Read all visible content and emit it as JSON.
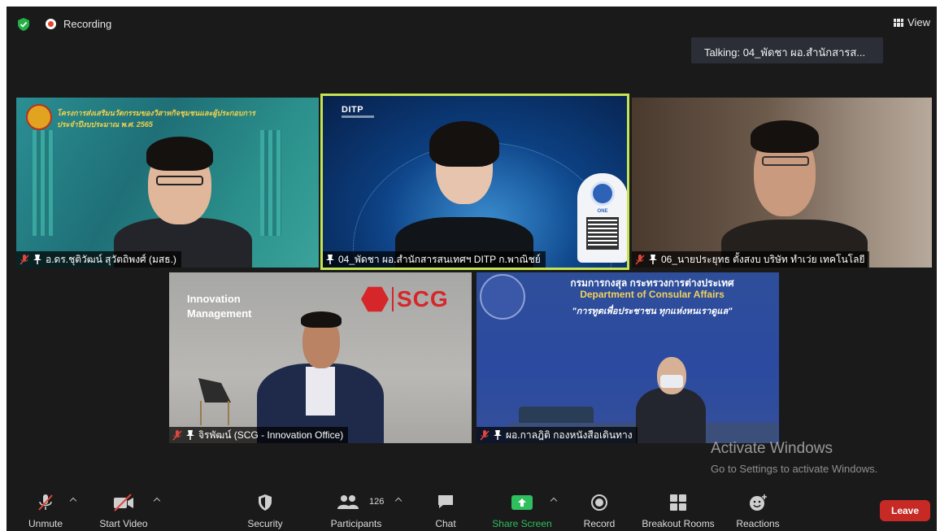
{
  "app": {
    "recording_label": "Recording",
    "view_label": "View",
    "talking_label": "Talking: 04_พัดชา ผอ.สำนักสารส..."
  },
  "tiles": [
    {
      "name": "อ.ดร.ชุติวัฒน์ สุวัตถิพงศ์ (มสธ.)",
      "banner_line1": "โครงการส่งเสริมนวัตกรรมของวิสาหกิจชุมชนและผู้ประกอบการ",
      "banner_line2": "ประจำปีงบประมาณ พ.ศ. 2565"
    },
    {
      "name": "04_พัดชา ผอ.สำนักสารสนเทศฯ DITP ก.พาณิชย์",
      "logo_text": "DITP",
      "badge_text": "ONE",
      "active_speaker": true
    },
    {
      "name": "06_นายประยุทธ ตั้งสงบ บริษัท ทำเว่ย เทคโนโลยี"
    },
    {
      "name": "จิรพัฒน์ (SCG - Innovation Office)",
      "wall_text": "Innovation\nManagement",
      "brand_text": "SCG"
    },
    {
      "name": "ผอ.กาลฎิติ กองหนังสือเดินทาง",
      "banner_th": "กรมการกงสุล กระทรวงการต่างประเทศ",
      "banner_en": "Department of Consular Affairs",
      "banner_slogan": "\"การทูตเพื่อประชาชน ทุกแห่งหนเราดูแล\""
    }
  ],
  "watermark": {
    "title": "Activate Windows",
    "subtitle": "Go to Settings to activate Windows."
  },
  "toolbar": {
    "unmute": "Unmute",
    "start_video": "Start Video",
    "security": "Security",
    "participants": "Participants",
    "participants_count": "126",
    "chat": "Chat",
    "share_screen": "Share Screen",
    "record": "Record",
    "breakout_rooms": "Breakout Rooms",
    "reactions": "Reactions",
    "leave": "Leave"
  },
  "colors": {
    "background": "#1a1a1a",
    "active_speaker_border": "#c4e453",
    "share_screen_green": "#2fbf5f",
    "leave_red": "#c72a25",
    "recording_red": "#e8412e"
  },
  "icons": [
    "shield-icon",
    "recording-icon",
    "view-grid-icon",
    "muted-mic-icon",
    "pin-icon",
    "video-off-icon",
    "participants-icon",
    "chat-icon",
    "share-screen-icon",
    "record-icon",
    "breakout-rooms-icon",
    "reactions-icon"
  ]
}
